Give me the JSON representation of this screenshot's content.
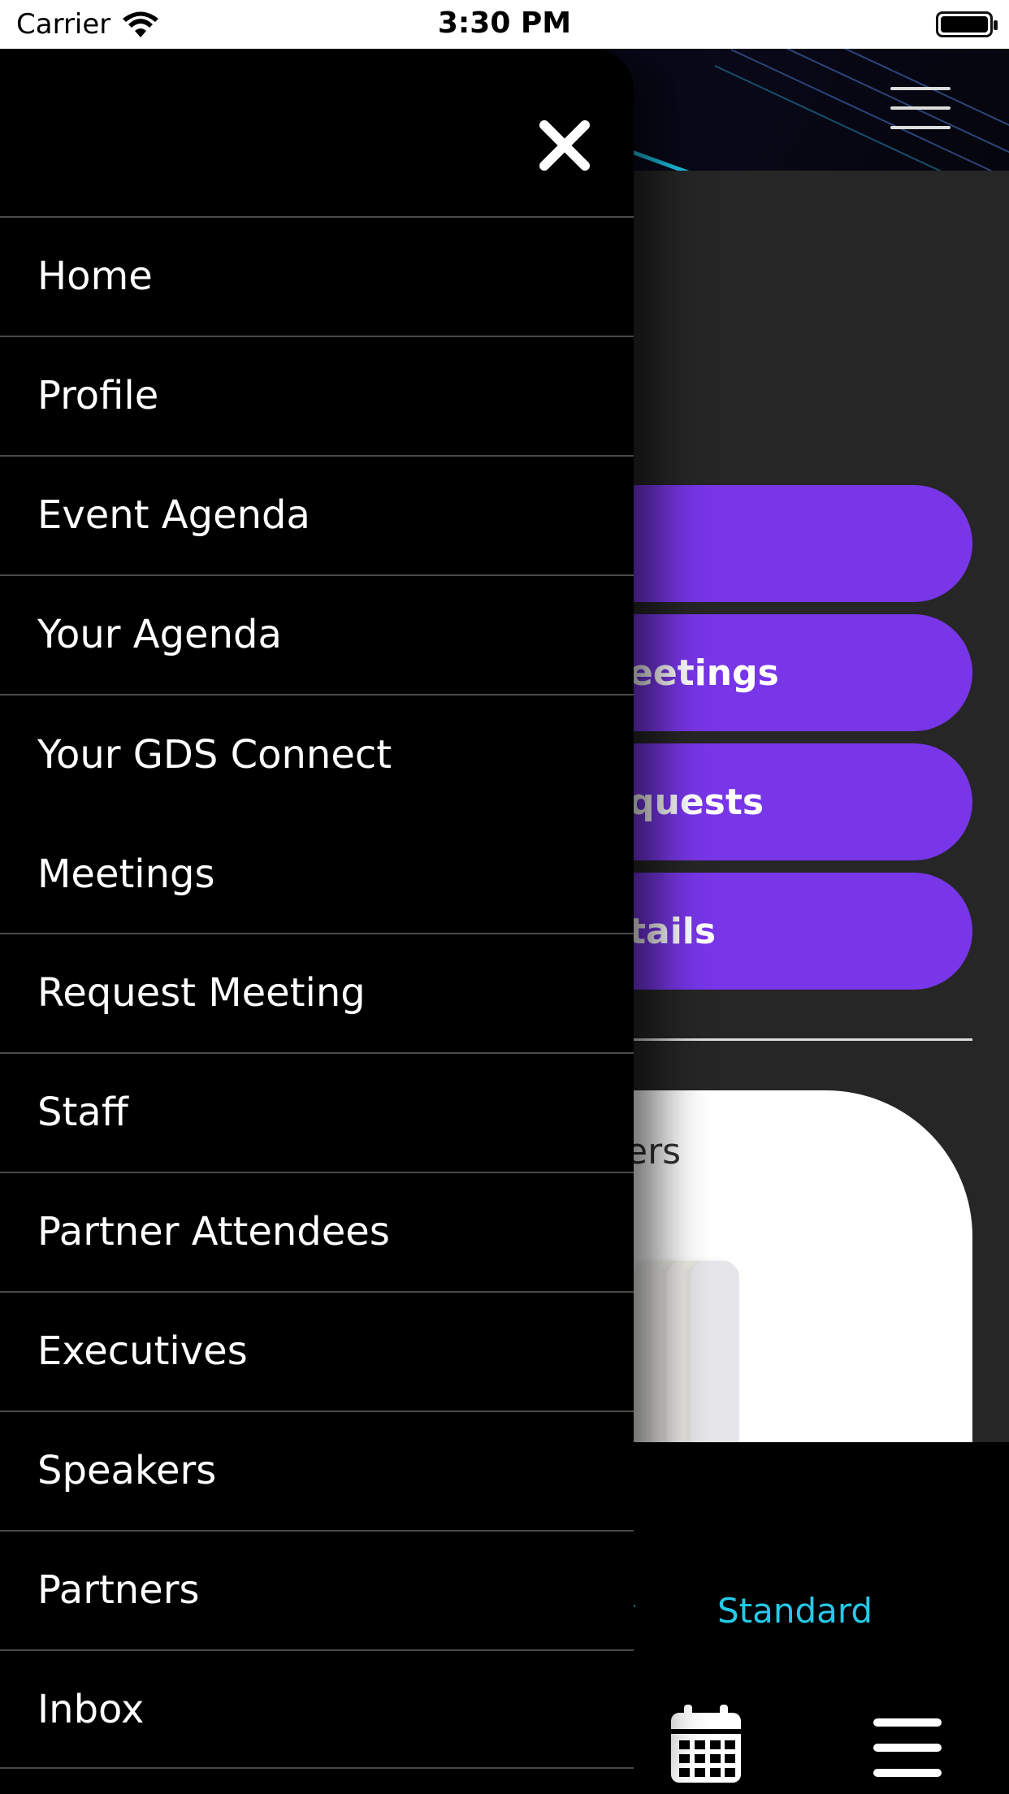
{
  "status_bar": {
    "carrier": "Carrier",
    "time": "3:30 PM"
  },
  "background": {
    "buttons": [
      "eetings",
      "quests",
      "tails"
    ],
    "card_title": "ers",
    "tab_label": "Standard"
  },
  "drawer": {
    "items": [
      "Home",
      "Profile",
      "Event Agenda",
      "Your Agenda",
      "Your GDS Connect\nMeetings",
      "Request Meeting",
      "Staff",
      "Partner Attendees",
      "Executives",
      "Speakers",
      "Partners",
      "Inbox"
    ]
  },
  "colors": {
    "accent_purple": "#7836e8",
    "cyan": "#25c9e8",
    "drawer_bg": "#000000"
  }
}
